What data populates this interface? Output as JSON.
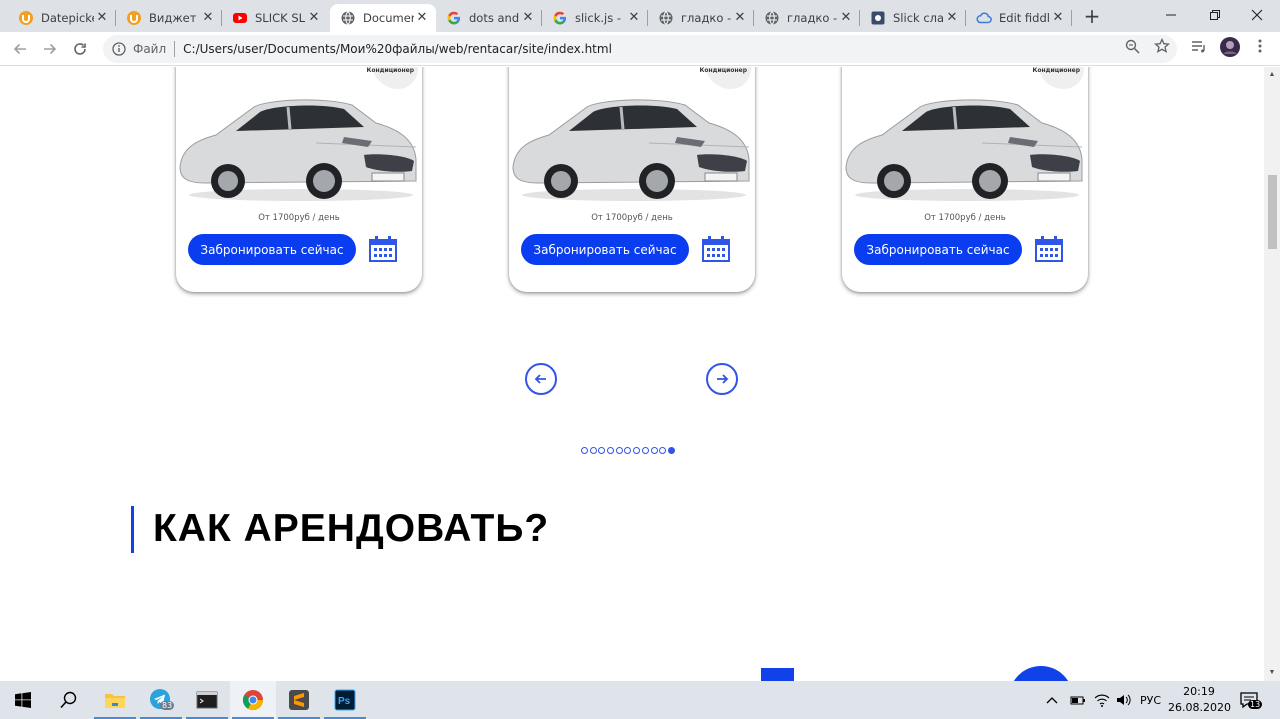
{
  "browser": {
    "tabs": [
      {
        "title": "Datepicke",
        "icon": "ucoz-icon"
      },
      {
        "title": "Виджет D",
        "icon": "ucoz-icon"
      },
      {
        "title": "SLICK SLI",
        "icon": "youtube-icon"
      },
      {
        "title": "Documen",
        "icon": "globe-icon",
        "active": true
      },
      {
        "title": "dots and",
        "icon": "google-icon"
      },
      {
        "title": "slick.js - ",
        "icon": "google-icon"
      },
      {
        "title": "гладко - ",
        "icon": "globe-icon"
      },
      {
        "title": "гладко - ",
        "icon": "globe-icon"
      },
      {
        "title": "Slick сла",
        "icon": "app-icon"
      },
      {
        "title": "Edit fiddl",
        "icon": "cloud-icon"
      }
    ],
    "close_glyph": "✕",
    "new_tab_glyph": "+",
    "address": {
      "scheme_label": "Файл",
      "url": "C:/Users/user/Documents/Мои%20файлы/web/rentacar/site/index.html"
    }
  },
  "page": {
    "cards": [
      {
        "tag": "Кондиционер",
        "price": "От 1700руб / день",
        "button": "Забронировать сейчас"
      },
      {
        "tag": "Кондиционер",
        "price": "От 1700руб / день",
        "button": "Забронировать сейчас"
      },
      {
        "tag": "Кондиционер",
        "price": "От 1700руб / день",
        "button": "Забронировать сейчас"
      }
    ],
    "slider": {
      "dot_count": 11,
      "active_dot": 10
    },
    "section_heading": "КАК АРЕНДОВАТЬ?",
    "colors": {
      "accent": "#0b3df0",
      "card_shadow": "#000000"
    }
  },
  "taskbar": {
    "apps": [
      "windows-start",
      "search-icon",
      "file-explorer-icon",
      "telegram-icon",
      "terminal-icon",
      "chrome-icon",
      "sublime-text-icon",
      "photoshop-icon"
    ],
    "telegram_badge": "83",
    "language": "РУС",
    "time": "20:19",
    "date": "26.08.2020",
    "notifications": "13"
  }
}
